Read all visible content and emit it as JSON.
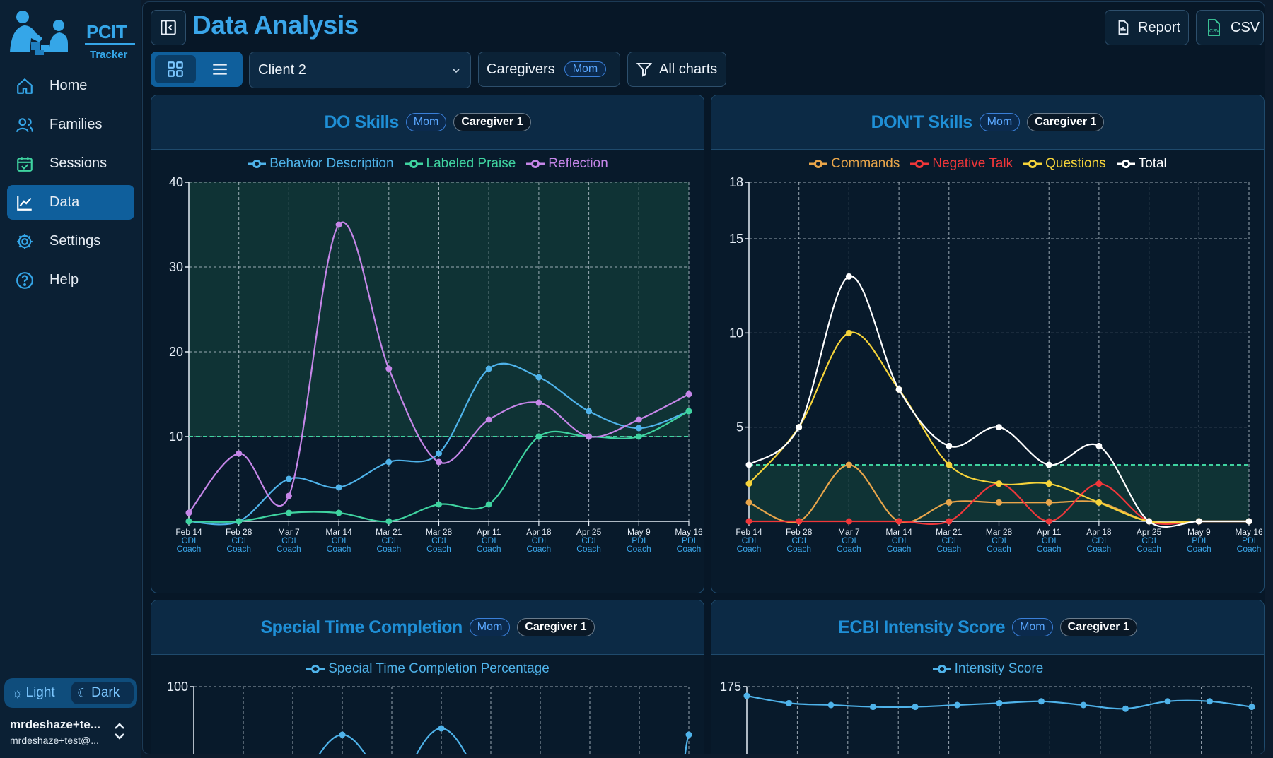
{
  "app": {
    "logo_title": "PCIT",
    "logo_subtitle": "Tracker"
  },
  "sidebar": {
    "items": [
      {
        "label": "Home",
        "icon": "home-icon"
      },
      {
        "label": "Families",
        "icon": "users-icon"
      },
      {
        "label": "Sessions",
        "icon": "calendar-check-icon"
      },
      {
        "label": "Data",
        "icon": "chart-line-icon",
        "active": true
      },
      {
        "label": "Settings",
        "icon": "gear-icon"
      },
      {
        "label": "Help",
        "icon": "help-circle-icon"
      }
    ],
    "theme": {
      "light": "Light",
      "dark": "Dark",
      "selected": "Dark"
    },
    "user": {
      "name": "mrdeshaze+te...",
      "email": "mrdeshaze+test@..."
    }
  },
  "header": {
    "title": "Data Analysis",
    "report_label": "Report",
    "csv_label": "CSV",
    "client_select": "Client 2",
    "caregivers_label": "Caregivers",
    "caregivers_badge": "Mom",
    "filter_label": "All charts"
  },
  "colors": {
    "blue": "#4fb3ea",
    "green": "#3fd3a0",
    "purple": "#c586e8",
    "orange": "#e8a54a",
    "red": "#f0373a",
    "yellow": "#f5d33a",
    "white": "#ffffff",
    "accent": "#3aa6ea"
  },
  "sessions": [
    {
      "date": "Feb 14",
      "type": "CDI",
      "kind": "Coach"
    },
    {
      "date": "Feb 28",
      "type": "CDI",
      "kind": "Coach"
    },
    {
      "date": "Mar 7",
      "type": "CDI",
      "kind": "Coach"
    },
    {
      "date": "Mar 14",
      "type": "CDI",
      "kind": "Coach"
    },
    {
      "date": "Mar 21",
      "type": "CDI",
      "kind": "Coach"
    },
    {
      "date": "Mar 28",
      "type": "CDI",
      "kind": "Coach"
    },
    {
      "date": "Apr 11",
      "type": "CDI",
      "kind": "Coach"
    },
    {
      "date": "Apr 18",
      "type": "CDI",
      "kind": "Coach"
    },
    {
      "date": "Apr 25",
      "type": "CDI",
      "kind": "Coach"
    },
    {
      "date": "May 9",
      "type": "PDI",
      "kind": "Coach"
    },
    {
      "date": "May 16",
      "type": "PDI",
      "kind": "Coach"
    }
  ],
  "cards": {
    "do": {
      "title": "DO Skills",
      "badge": "Mom",
      "caregiver": "Caregiver 1"
    },
    "dont": {
      "title": "DON'T Skills",
      "badge": "Mom",
      "caregiver": "Caregiver 1"
    },
    "special": {
      "title": "Special Time Completion",
      "badge": "Mom",
      "caregiver": "Caregiver 1"
    },
    "ecbi": {
      "title": "ECBI Intensity Score",
      "badge": "Mom",
      "caregiver": "Caregiver 1"
    }
  },
  "chart_data": [
    {
      "type": "line",
      "title": "DO Skills",
      "x": [
        "Feb 14",
        "Feb 28",
        "Mar 7",
        "Mar 14",
        "Mar 21",
        "Mar 28",
        "Apr 11",
        "Apr 18",
        "Apr 25",
        "May 9",
        "May 16"
      ],
      "ylim": [
        0,
        40
      ],
      "yticks": [
        10,
        20,
        30,
        40
      ],
      "target_line": 10,
      "target_zone": "above",
      "grid": true,
      "legend": "top-center",
      "series": [
        {
          "name": "Behavior Description",
          "color": "#4fb3ea",
          "values": [
            0,
            0,
            5,
            4,
            7,
            8,
            18,
            17,
            13,
            11,
            13
          ]
        },
        {
          "name": "Labeled Praise",
          "color": "#3fd3a0",
          "values": [
            0,
            0,
            1,
            1,
            0,
            2,
            2,
            10,
            10,
            10,
            13
          ]
        },
        {
          "name": "Reflection",
          "color": "#c586e8",
          "values": [
            1,
            8,
            3,
            35,
            18,
            7,
            12,
            14,
            10,
            12,
            15
          ]
        }
      ]
    },
    {
      "type": "line",
      "title": "DON'T Skills",
      "x": [
        "Feb 14",
        "Feb 28",
        "Mar 7",
        "Mar 14",
        "Mar 21",
        "Mar 28",
        "Apr 11",
        "Apr 18",
        "Apr 25",
        "May 9",
        "May 16"
      ],
      "ylim": [
        0,
        18
      ],
      "yticks": [
        5,
        10,
        15,
        18
      ],
      "target_line": 3,
      "target_zone": "below",
      "grid": true,
      "legend": "top-center",
      "series": [
        {
          "name": "Commands",
          "color": "#e8a54a",
          "values": [
            1,
            0,
            3,
            0,
            1,
            1,
            1,
            1,
            0,
            0,
            0
          ]
        },
        {
          "name": "Negative Talk",
          "color": "#f0373a",
          "values": [
            0,
            0,
            0,
            0,
            0,
            2,
            0,
            2,
            0,
            0,
            0
          ]
        },
        {
          "name": "Questions",
          "color": "#f5d33a",
          "values": [
            2,
            5,
            10,
            7,
            3,
            2,
            2,
            1,
            0,
            0,
            0
          ]
        },
        {
          "name": "Total",
          "color": "#ffffff",
          "values": [
            3,
            5,
            13,
            7,
            4,
            5,
            3,
            4,
            0,
            0,
            0
          ]
        }
      ]
    },
    {
      "type": "line",
      "title": "Special Time Completion",
      "ylim": [
        0,
        100
      ],
      "yticks": [
        100
      ],
      "grid": true,
      "legend": "top-center",
      "series": [
        {
          "name": "Special Time Completion Percentage",
          "color": "#4fb3ea"
        }
      ]
    },
    {
      "type": "line",
      "title": "ECBI Intensity Score",
      "yticks": [
        175
      ],
      "grid": true,
      "legend": "top-center",
      "series": [
        {
          "name": "Intensity Score",
          "color": "#4fb3ea",
          "values": [
            170,
            166,
            165,
            164,
            164,
            165,
            166,
            167,
            165,
            163,
            167,
            167,
            164
          ]
        }
      ]
    }
  ]
}
